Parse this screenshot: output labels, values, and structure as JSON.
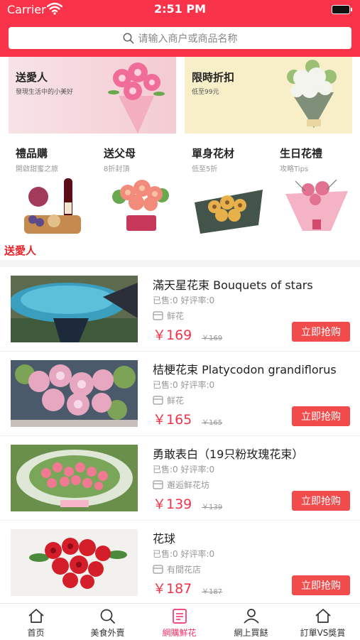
{
  "status": {
    "carrier": "Carrier",
    "time": "2:51 PM"
  },
  "search": {
    "placeholder": "请输入商户或商品名称"
  },
  "banners": [
    {
      "title": "送愛人",
      "subtitle": "發現生活中的小美好"
    },
    {
      "title": "限時折扣",
      "subtitle": "低至99元"
    }
  ],
  "categories": [
    {
      "title": "禮品購",
      "subtitle": "開啟甜蜜之旅"
    },
    {
      "title": "送父母",
      "subtitle": "8折封頂"
    },
    {
      "title": "單身花材",
      "subtitle": "低至5折"
    },
    {
      "title": "生日花禮",
      "subtitle": "攻略Tips"
    }
  ],
  "section_title": "送愛人",
  "products": [
    {
      "name": "滿天星花束 Bouquets of stars",
      "stats": "已售:0 好评率:0",
      "shop": "鲜花",
      "price": "￥169",
      "old_price": "￥169",
      "buy_label": "立即抢购"
    },
    {
      "name": "桔梗花束 Platycodon grandiflorus",
      "stats": "已售:0 好评率:0",
      "shop": "鲜花",
      "price": "￥165",
      "old_price": "￥165",
      "buy_label": "立即抢购"
    },
    {
      "name": "勇敢表白（19只粉玫瑰花束）",
      "stats": "已售:0 好评率:0",
      "shop": "邂逅鲜花坊",
      "price": "￥139",
      "old_price": "￥139",
      "buy_label": "立即抢购"
    },
    {
      "name": "花球",
      "stats": "已售:0 好评率:0",
      "shop": "有間花店",
      "price": "￥187",
      "old_price": "￥187",
      "buy_label": "立即抢购"
    }
  ],
  "tabs": [
    {
      "label": "首页",
      "icon": "home-icon"
    },
    {
      "label": "美食外賣",
      "icon": "search-icon"
    },
    {
      "label": "網購鮮花",
      "icon": "list-icon",
      "active": true
    },
    {
      "label": "網上買餸",
      "icon": "person-icon"
    },
    {
      "label": "訂單VS獎賞",
      "icon": "home-icon"
    }
  ],
  "colors": {
    "brand": "#f9344a",
    "price": "#f2334a",
    "buy_button": "#f14b4b",
    "active_tab": "#f4356b",
    "section_title": "#e8242a"
  }
}
